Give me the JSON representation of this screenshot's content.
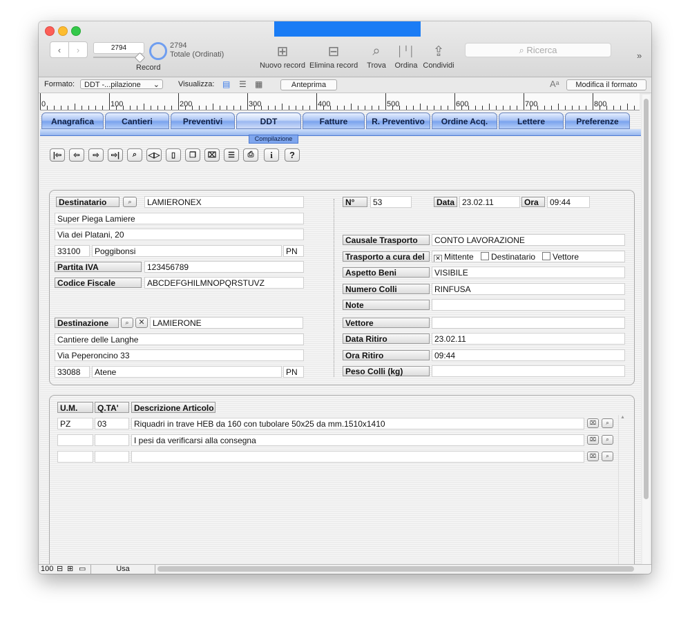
{
  "toolbar": {
    "record_value": "2794",
    "record_label": "Record",
    "count": "2794",
    "count_label": "Totale (Ordinati)",
    "new_record": "Nuovo record",
    "delete_record": "Elimina record",
    "find": "Trova",
    "sort": "Ordina",
    "share": "Condividi",
    "search_placeholder": "Ricerca"
  },
  "formatbar": {
    "format_label": "Formato:",
    "format_value": "DDT -...pilazione",
    "view_label": "Visualizza:",
    "preview": "Anteprima",
    "modify_format": "Modifica il formato"
  },
  "ruler": {
    "marks": [
      "0",
      "100",
      "200",
      "300",
      "400",
      "500",
      "600",
      "700",
      "800"
    ]
  },
  "tabs": [
    "Anagrafica",
    "Cantieri",
    "Preventivi",
    "DDT",
    "Fatture",
    "R. Preventivo",
    "Ordine Acq.",
    "Lettere",
    "Preferenze"
  ],
  "subtab": "Compilazione",
  "form": {
    "destinatario_label": "Destinatario",
    "destinatario_code": "LAMIERONEX",
    "dest_name": "Super Piega Lamiere",
    "dest_address": "Via dei Platani, 20",
    "dest_cap": "33100",
    "dest_city": "Poggibonsi",
    "dest_prov": "PN",
    "piva_label": "Partita IVA",
    "piva": "123456789",
    "cf_label": "Codice Fiscale",
    "cf": "ABCDEFGHILMNOPQRSTUVZ",
    "destinazione_label": "Destinazione",
    "destinazione_code": "LAMIERONE",
    "dz_name": "Cantiere delle Langhe",
    "dz_address": "Via Peperoncino 33",
    "dz_cap": "33088",
    "dz_city": "Atene",
    "dz_prov": "PN",
    "num_label": "N°",
    "num": "53",
    "data_label": "Data",
    "data": "23.02.11",
    "ora_label": "Ora",
    "ora": "09:44",
    "causale_label": "Causale Trasporto",
    "causale": "CONTO LAVORAZIONE",
    "trasporto_label": "Trasporto a cura del",
    "opt_mittente": "Mittente",
    "opt_destinatario": "Destinatario",
    "opt_vettore": "Vettore",
    "aspetto_label": "Aspetto Beni",
    "aspetto": "VISIBILE",
    "colli_label": "Numero Colli",
    "colli": "RINFUSA",
    "note_label": "Note",
    "note": "",
    "vettore_label": "Vettore",
    "vettore": "",
    "data_ritiro_label": "Data Ritiro",
    "data_ritiro": "23.02.11",
    "ora_ritiro_label": "Ora Ritiro",
    "ora_ritiro": "09:44",
    "peso_label": "Peso Colli (kg)",
    "peso": ""
  },
  "items": {
    "headers": [
      "U.M.",
      "Q.TA'",
      "Descrizione Articolo"
    ],
    "rows": [
      {
        "um": "PZ",
        "qta": "03",
        "desc": "Riquadri in trave HEB da 160  con tubolare 50x25  da mm.1510x1410"
      },
      {
        "um": "",
        "qta": "",
        "desc": "I pesi da verificarsi alla consegna"
      },
      {
        "um": "",
        "qta": "",
        "desc": ""
      }
    ]
  },
  "status": {
    "zoom": "100",
    "mode": "Usa"
  }
}
